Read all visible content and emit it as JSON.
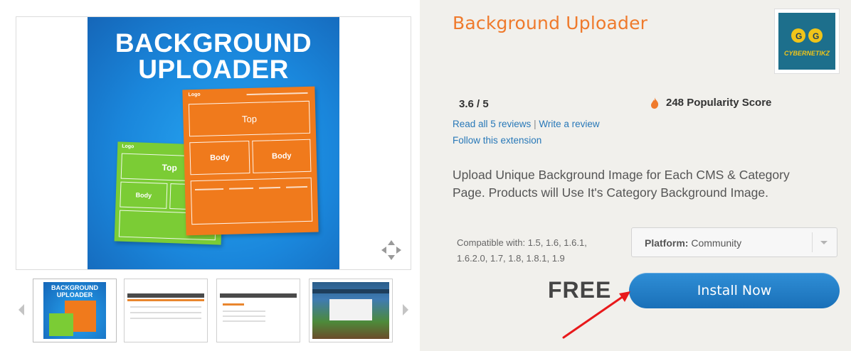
{
  "gallery": {
    "hero_title_line1": "BACKGROUND",
    "hero_title_line2": "UPLOADER",
    "mock": {
      "logo": "Logo",
      "top": "Top",
      "body": "Body"
    },
    "thumbnails": [
      {
        "title_line1": "BACKGROUND",
        "title_line2": "UPLOADER"
      },
      {
        "title_line1": "",
        "title_line2": ""
      },
      {
        "title_line1": "",
        "title_line2": ""
      },
      {
        "title_line1": "",
        "title_line2": ""
      }
    ],
    "colors": {
      "hero_blue": "#1a86db",
      "orange": "#f07a1c",
      "green": "#7bcc35"
    }
  },
  "product": {
    "title": "Background Uploader",
    "vendor_logo_text": "CYBERNETIKZ",
    "rating": "3.6 / 5",
    "read_reviews": "Read all 5 reviews",
    "separator": "|",
    "write_review": "Write a review",
    "follow": "Follow this extension",
    "popularity": "248 Popularity Score",
    "description": "Upload Unique Background Image for Each CMS & Category Page. Products will Use It's Category Background Image.",
    "compat_line1": "Compatible with: 1.5, 1.6, 1.6.1,",
    "compat_line2": "1.6.2.0, 1.7, 1.8, 1.8.1, 1.9",
    "platform_label": "Platform:",
    "platform_value": "Community",
    "price": "FREE",
    "install_label": "Install Now",
    "colors": {
      "title": "#ef7a2c",
      "link": "#2878b8",
      "button": "#1f7ec6",
      "annotation": "#e8191b"
    }
  }
}
